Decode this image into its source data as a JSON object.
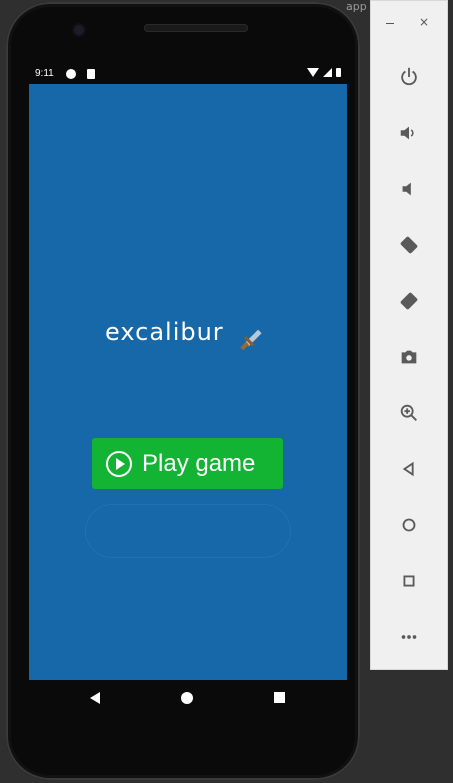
{
  "editor": {
    "tab_text": "app"
  },
  "status": {
    "time": "9:11"
  },
  "game": {
    "logo_text": "excalibur",
    "play_button_label": "Play game"
  },
  "emulator": {
    "actions": [
      "power",
      "volume-up",
      "volume-down",
      "rotate-left",
      "rotate-right",
      "screenshot",
      "zoom",
      "back",
      "home",
      "overview",
      "more"
    ]
  }
}
